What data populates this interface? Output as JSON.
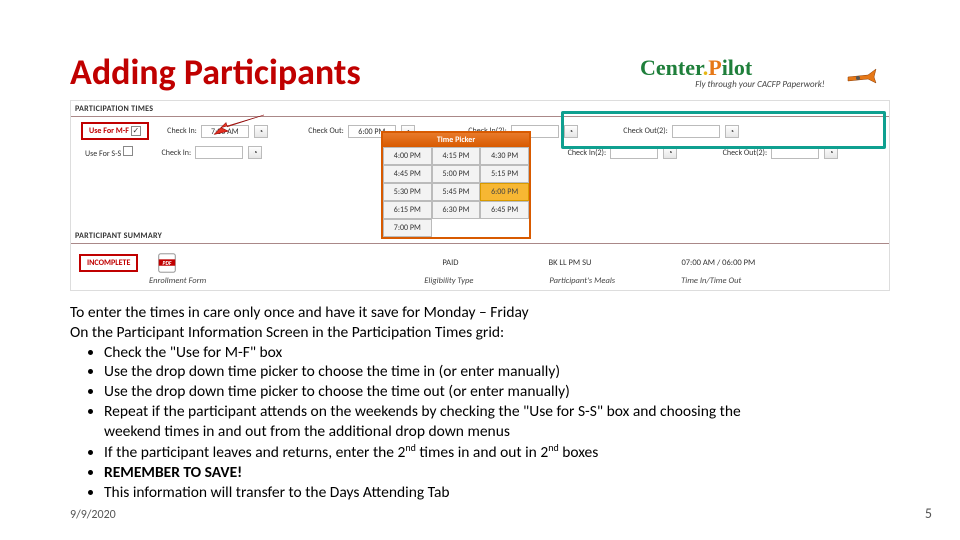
{
  "title": "Adding Participants",
  "logo": {
    "part1": "Center",
    "part2": "P",
    "part3": "ilot",
    "tagline": "Fly through your CACFP Paperwork!"
  },
  "shot": {
    "section1": "PARTICIPATION TIMES",
    "useMF": "Use For M-F",
    "useSS": "Use For S-S",
    "checkIn": "Check In:",
    "checkOut": "Check Out:",
    "checkIn2": "Check In(2):",
    "checkOut2": "Check Out(2):",
    "t1": "7:00 AM",
    "t2": "6:00 PM",
    "cbMF": "✓",
    "cbSS": "",
    "picker": {
      "title": "Time Picker",
      "cells": [
        "4:00 PM",
        "4:15 PM",
        "4:30 PM",
        "4:45 PM",
        "5:00 PM",
        "5:15 PM",
        "5:30 PM",
        "5:45 PM",
        "",
        "6:15 PM",
        "6:30 PM",
        "6:45 PM",
        "7:00 PM",
        "",
        ""
      ],
      "selected": "6:00 PM"
    },
    "section2": "PARTICIPANT SUMMARY",
    "incomplete": "INCOMPLETE",
    "sumEnroll": "Enrollment Form",
    "sumElig": "Eligibility Type",
    "sumPaid": "PAID",
    "sumMeals": "Participant's Meals",
    "sumMealsV": "BK LL PM SU",
    "sumTime": "Time In/Time Out",
    "sumTimeV": "07:00 AM / 06:00 PM"
  },
  "body": {
    "p1": "To enter the times in care only once and have it save for Monday – Friday",
    "p2": "On the Participant Information Screen in the Participation Times grid:",
    "b1": "Check the \"Use for M-F\" box",
    "b2": "Use the drop down time picker to choose the time in (or enter manually)",
    "b3": "Use the drop down time picker to choose the time out (or enter manually)",
    "b4a": "Repeat if the participant attends on the weekends by checking the \"Use for S-S\" box and choosing the",
    "b4b": "weekend times in and out from the additional drop down menus",
    "b5a": "If the participant leaves and returns, enter the 2",
    "b5b": " times in and out in 2",
    "b5c": " boxes",
    "nd": "nd",
    "b6": "REMEMBER TO SAVE!",
    "b7": "This information will transfer to the Days Attending Tab"
  },
  "footer": {
    "date": "9/9/2020",
    "page": "5"
  }
}
